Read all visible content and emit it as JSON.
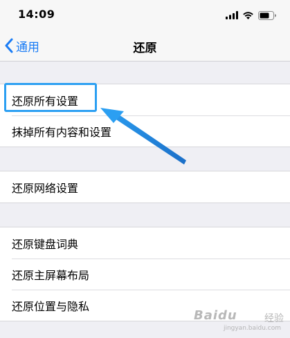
{
  "status_bar": {
    "time": "14:09"
  },
  "nav": {
    "back_label": "通用",
    "title": "还原"
  },
  "groups": [
    {
      "items": [
        {
          "label": "还原所有设置"
        },
        {
          "label": "抹掉所有内容和设置"
        }
      ]
    },
    {
      "items": [
        {
          "label": "还原网络设置"
        }
      ]
    },
    {
      "items": [
        {
          "label": "还原键盘词典"
        },
        {
          "label": "还原主屏幕布局"
        },
        {
          "label": "还原位置与隐私"
        }
      ]
    }
  ],
  "annotation": {
    "color": "#2b9ff2"
  },
  "watermark": {
    "logo": "Baidu",
    "sub": "经验",
    "url": "jingyan.baidu.com"
  },
  "colors": {
    "accent": "#1a7cf5",
    "background": "#efeff4"
  }
}
